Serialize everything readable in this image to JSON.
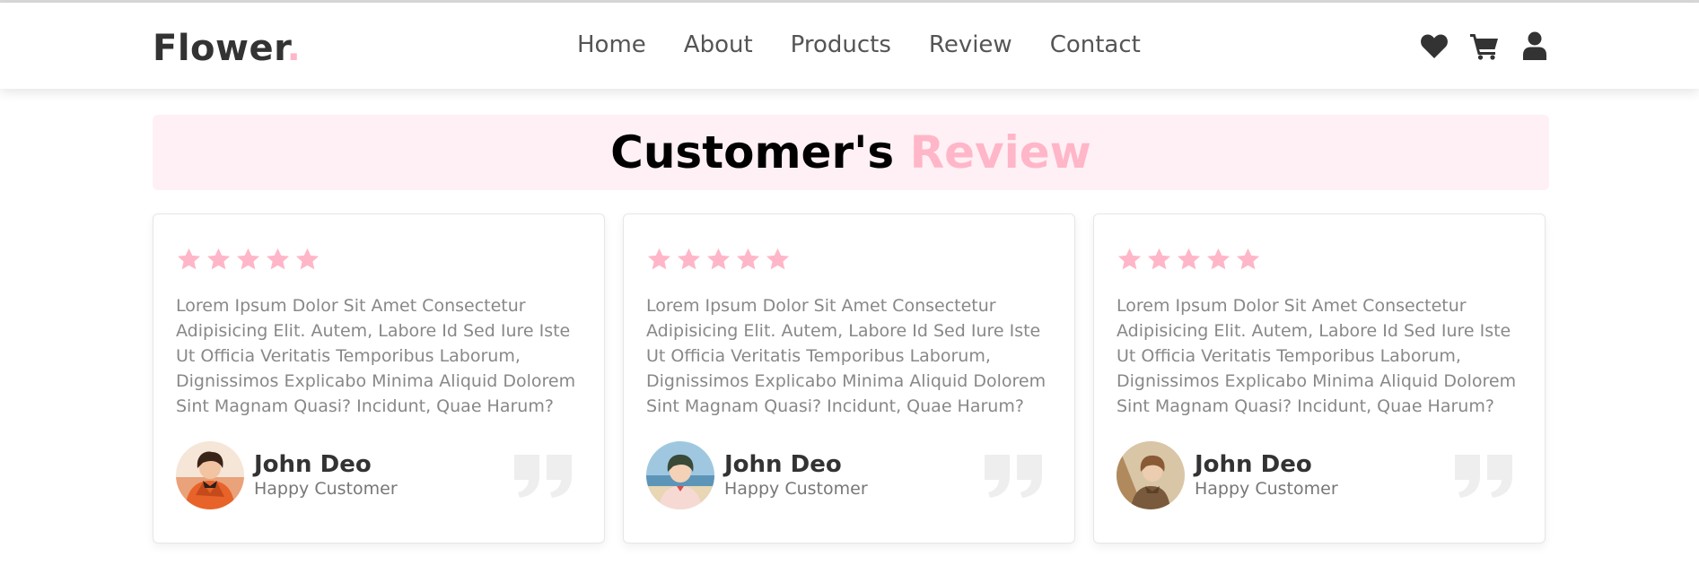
{
  "brand": {
    "name": "Flower",
    "dot": ".",
    "accent_color": "#ffb6c8"
  },
  "nav": {
    "items": [
      {
        "label": "Home"
      },
      {
        "label": "About"
      },
      {
        "label": "Products"
      },
      {
        "label": "Review"
      },
      {
        "label": "Contact"
      }
    ]
  },
  "header_icons": [
    "heart-icon",
    "shopping-cart-icon",
    "user-icon"
  ],
  "section": {
    "title_main": "Customer's",
    "title_accent": "Review",
    "background_color": "#fff0f5"
  },
  "reviews": [
    {
      "rating": 5,
      "text": "Lorem Ipsum Dolor Sit Amet Consectetur Adipisicing Elit. Autem, Labore Id Sed Iure Iste Ut Officia Veritatis Temporibus Laborum, Dignissimos Explicabo Minima Aliquid Dolorem Sint Magnam Quasi? Incidunt, Quae Harum?",
      "name": "John Deo",
      "role": "Happy Customer",
      "avatar": "avatar-orange"
    },
    {
      "rating": 5,
      "text": "Lorem Ipsum Dolor Sit Amet Consectetur Adipisicing Elit. Autem, Labore Id Sed Iure Iste Ut Officia Veritatis Temporibus Laborum, Dignissimos Explicabo Minima Aliquid Dolorem Sint Magnam Quasi? Incidunt, Quae Harum?",
      "name": "John Deo",
      "role": "Happy Customer",
      "avatar": "avatar-beach"
    },
    {
      "rating": 5,
      "text": "Lorem Ipsum Dolor Sit Amet Consectetur Adipisicing Elit. Autem, Labore Id Sed Iure Iste Ut Officia Veritatis Temporibus Laborum, Dignissimos Explicabo Minima Aliquid Dolorem Sint Magnam Quasi? Incidunt, Quae Harum?",
      "name": "John Deo",
      "role": "Happy Customer",
      "avatar": "avatar-brown"
    }
  ],
  "colors": {
    "star": "#ffb6c8",
    "quote_mark": "#eeeeee",
    "text": "#888888"
  }
}
